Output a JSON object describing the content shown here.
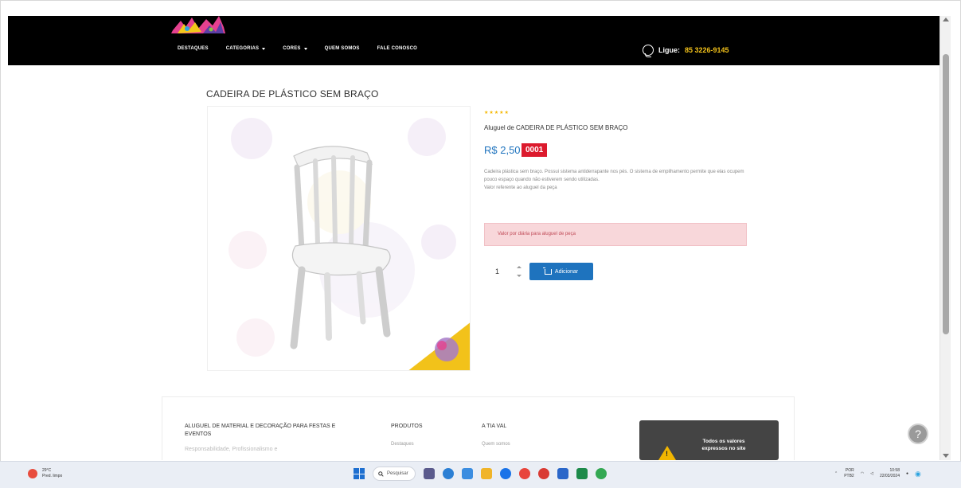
{
  "header": {
    "nav": [
      {
        "label": "DESTAQUES",
        "dropdown": false
      },
      {
        "label": "CATEGORIAS",
        "dropdown": true
      },
      {
        "label": "CORES",
        "dropdown": true
      },
      {
        "label": "QUEM SOMOS",
        "dropdown": false
      },
      {
        "label": "FALE CONOSCO",
        "dropdown": false
      }
    ],
    "phone_prefix": "Ligue:",
    "phone_number": "85 3226-9145"
  },
  "product": {
    "title": "CADEIRA DE PLÁSTICO SEM BRAÇO",
    "stars": "★★★★★",
    "subtitle": "Aluguel de CADEIRA DE PLÁSTICO SEM BRAÇO",
    "price": "R$ 2,50",
    "code": "0001",
    "description_1": "Cadeira plástica sem braço. Possui sistema antiderrapante nos pés. O sistema de empilhamento permite que elas ocupem pouco espaço quando não estiverem sendo utilizadas.",
    "description_2": "Valor referente ao aluguel da peça",
    "alert": "Valor por diária para aluguel de peça",
    "quantity": "1",
    "add_label": "Adicionar"
  },
  "footer": {
    "col1_title": "ALUGUEL DE MATERIAL E DECORAÇÃO PARA FESTAS E EVENTOS",
    "col1_text": "Responsabilidade, Profissionalismo e",
    "col2_title": "PRODUTOS",
    "col2_link": "Destaques",
    "col3_title": "A TIA VAL",
    "col3_link": "Quem somos"
  },
  "toast": {
    "text": "Todos os valores expressos no site"
  },
  "help": {
    "label": "?"
  },
  "taskbar": {
    "weather_temp": "29°C",
    "weather_desc": "Pred. limpo",
    "search_placeholder": "Pesquisar",
    "lang_1": "POR",
    "lang_2": "PTB2",
    "time": "10:58",
    "date": "22/03/2024"
  },
  "colors": {
    "header_bg": "#000000",
    "accent_blue": "#1e73be",
    "code_red": "#dc1a2d",
    "phone_yellow": "#f3c21a",
    "alert_bg": "#f8d7da"
  }
}
